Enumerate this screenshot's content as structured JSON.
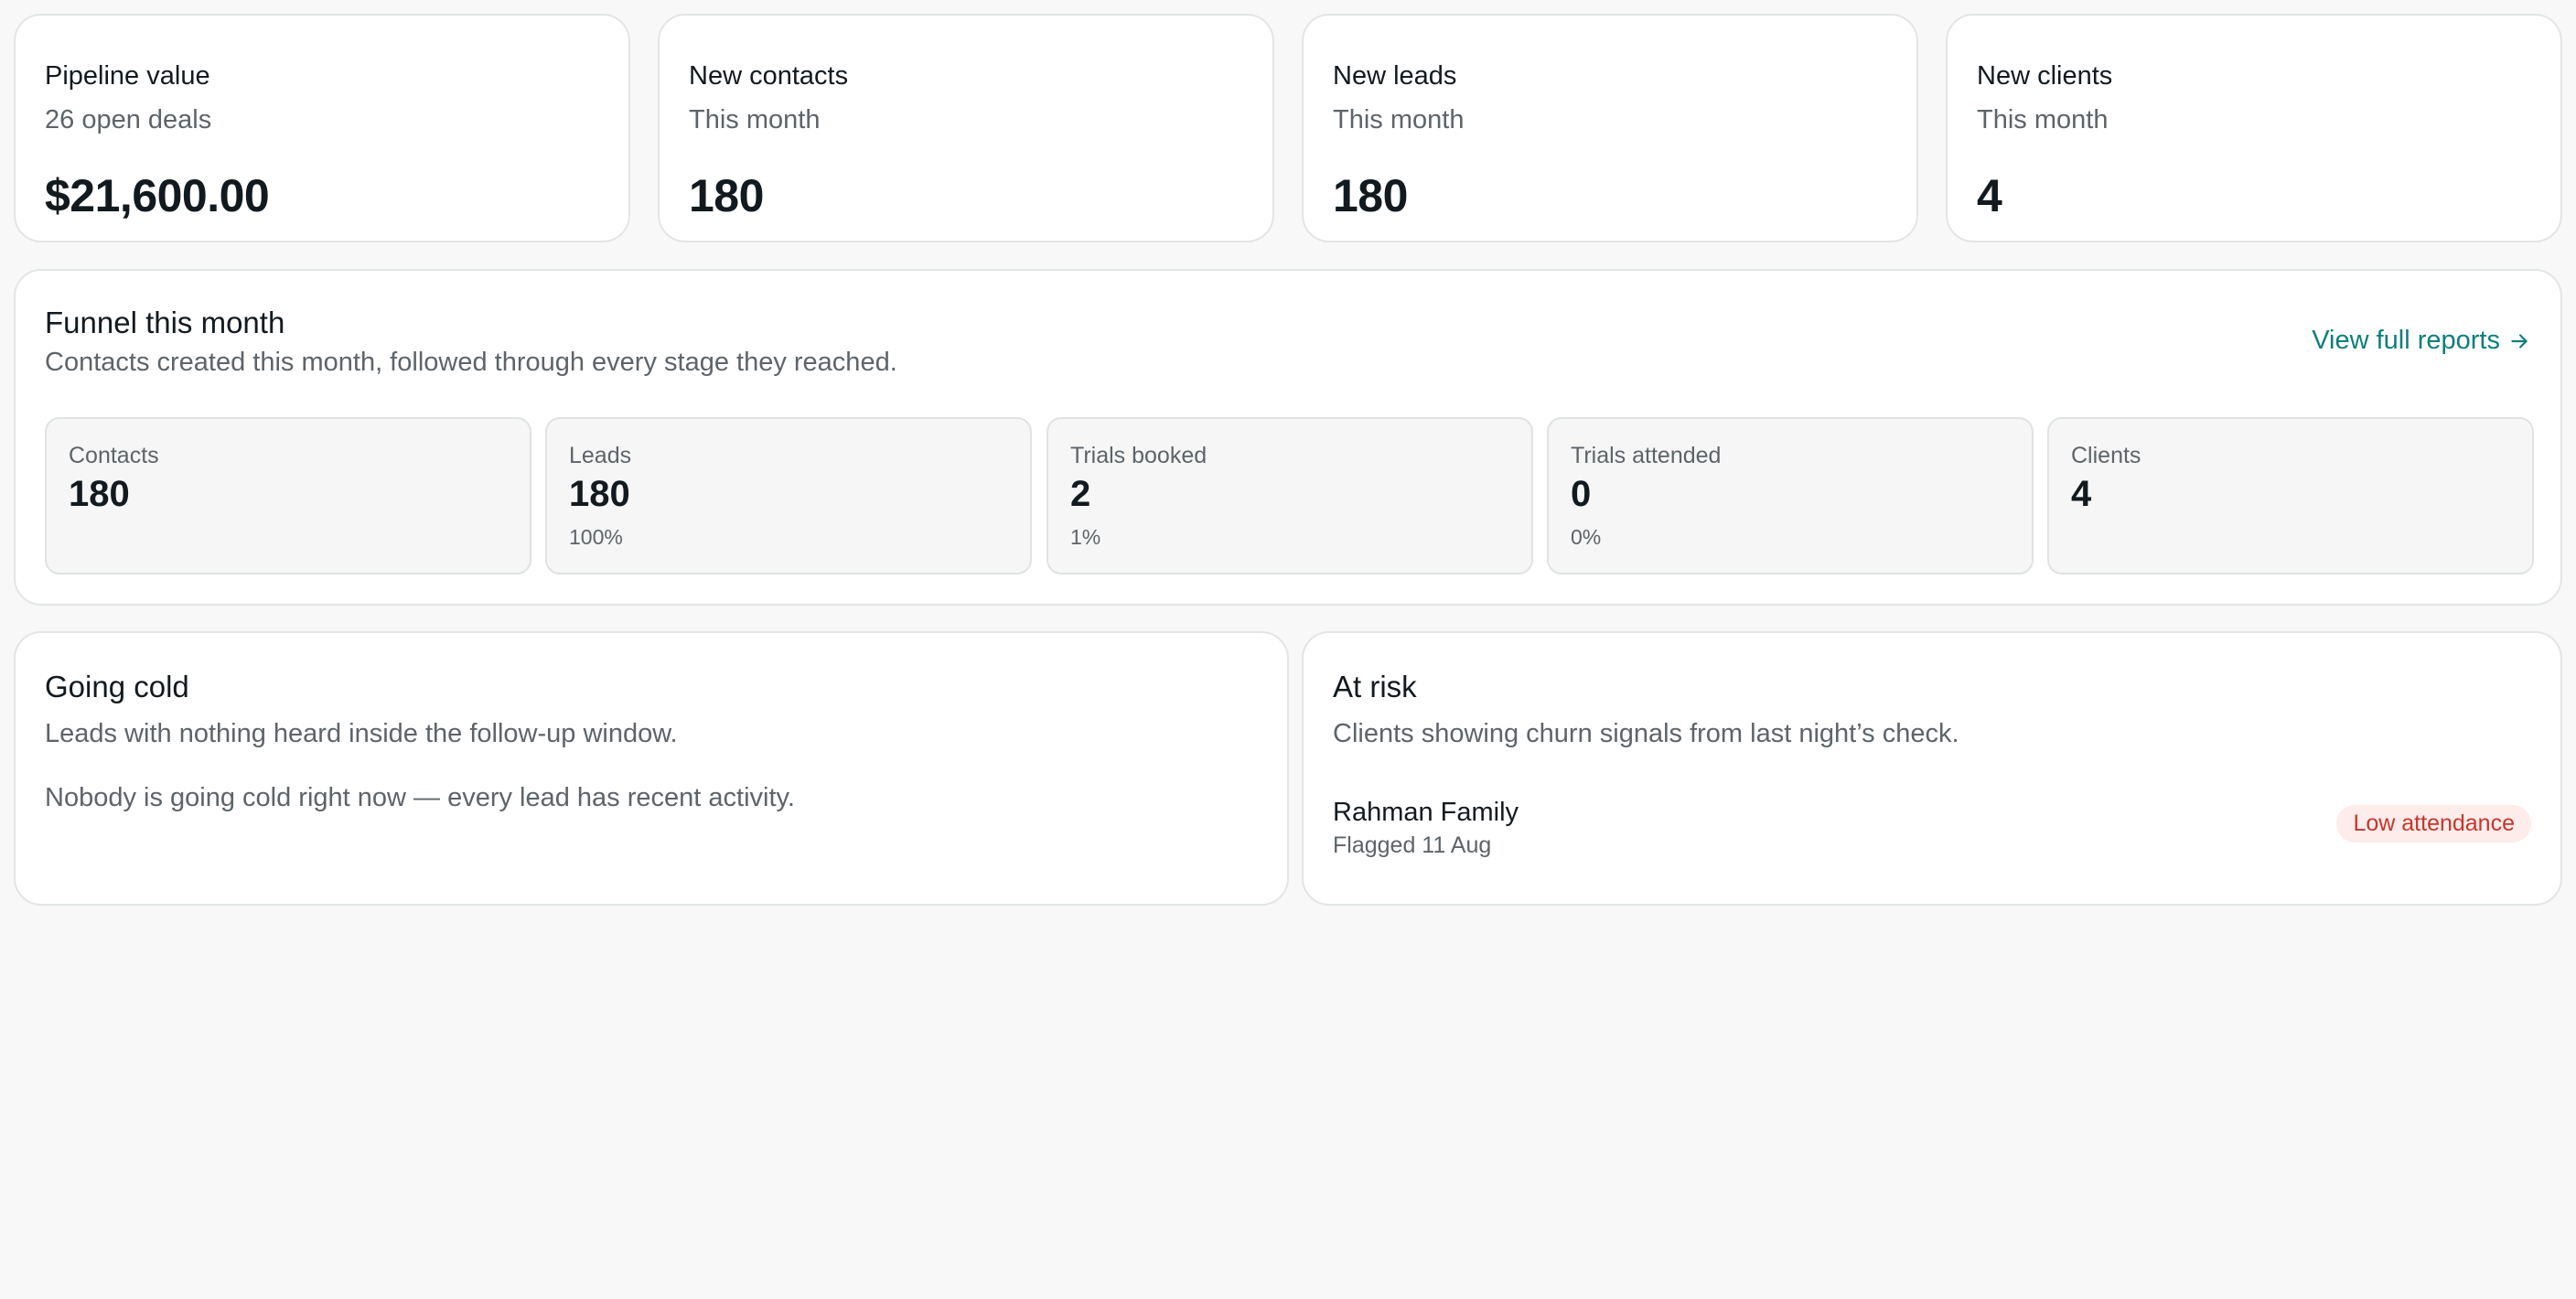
{
  "kpis": [
    {
      "title": "Pipeline value",
      "subtitle": "26 open deals",
      "value": "$21,600.00"
    },
    {
      "title": "New contacts",
      "subtitle": "This month",
      "value": "180"
    },
    {
      "title": "New leads",
      "subtitle": "This month",
      "value": "180"
    },
    {
      "title": "New clients",
      "subtitle": "This month",
      "value": "4"
    }
  ],
  "funnel": {
    "title": "Funnel this month",
    "subtitle": "Contacts created this month, followed through every stage they reached.",
    "link_label": "View full reports",
    "link_icon": "arrow-right-icon",
    "stages": [
      {
        "label": "Contacts",
        "value": "180",
        "pct": ""
      },
      {
        "label": "Leads",
        "value": "180",
        "pct": "100%"
      },
      {
        "label": "Trials booked",
        "value": "2",
        "pct": "1%"
      },
      {
        "label": "Trials attended",
        "value": "0",
        "pct": "0%"
      },
      {
        "label": "Clients",
        "value": "4",
        "pct": ""
      }
    ]
  },
  "going_cold": {
    "title": "Going cold",
    "subtitle": "Leads with nothing heard inside the follow-up window.",
    "empty_message": "Nobody is going cold right now — every lead has recent activity."
  },
  "at_risk": {
    "title": "At risk",
    "subtitle": "Clients showing churn signals from last night’s check.",
    "items": [
      {
        "name": "Rahman Family",
        "flagged": "Flagged 11 Aug",
        "badge": "Low attendance"
      }
    ]
  },
  "colors": {
    "accent": "#0f7e7a",
    "badge_bg": "#fdecea",
    "badge_text": "#c8352b",
    "background": "#f7f8f7"
  }
}
